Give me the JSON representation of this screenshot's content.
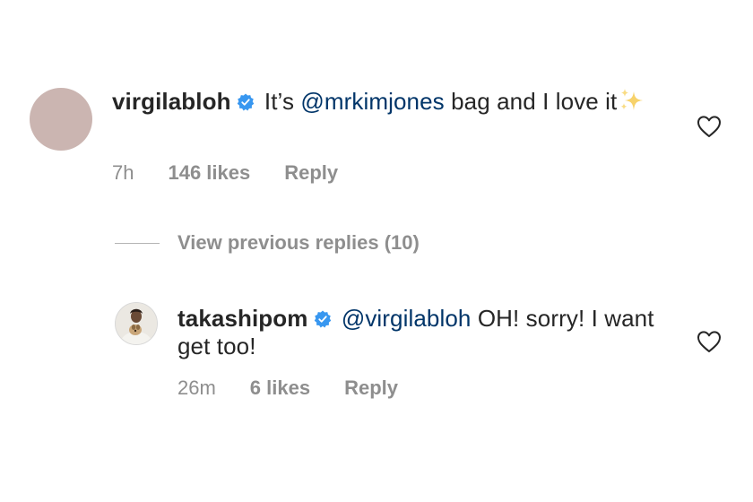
{
  "comments": [
    {
      "username": "virgilabloh",
      "text_before": " It’s ",
      "mention": "@mrkimjones",
      "text_after": " bag and I love it",
      "time": "7h",
      "likes": "146 likes",
      "reply_label": "Reply",
      "verified": true,
      "avatar_color": "#cbb5b1"
    },
    {
      "username": "takashipom",
      "text_before": " ",
      "mention": "@virgilabloh",
      "text_after": " OH! sorry! I want get too!",
      "time": "26m",
      "likes": "6 likes",
      "reply_label": "Reply",
      "verified": true
    }
  ],
  "view_previous_replies": "View previous replies (10)",
  "colors": {
    "verified_blue": "#3897f0",
    "mention": "#003569",
    "meta_gray": "#8e8e8e",
    "text": "#262626"
  },
  "icons": {
    "verified": "verified-badge-icon",
    "like": "heart-outline-icon",
    "emoji": "sparkles-emoji"
  }
}
